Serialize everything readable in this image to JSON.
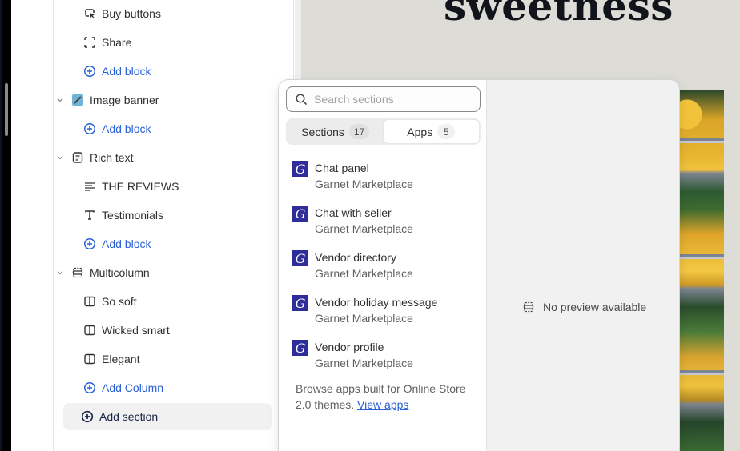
{
  "preview": {
    "headline": "sweetness"
  },
  "sidebar": {
    "items": [
      {
        "type": "block",
        "label": "Buy buttons",
        "icon": "cursor-click-icon"
      },
      {
        "type": "block",
        "label": "Share",
        "icon": "share-frame-icon"
      },
      {
        "type": "add",
        "label": "Add block",
        "icon": "plus-circle-icon"
      },
      {
        "type": "section",
        "label": "Image banner",
        "icon": "image-thumbnail-icon"
      },
      {
        "type": "add",
        "label": "Add block",
        "icon": "plus-circle-icon"
      },
      {
        "type": "section",
        "label": "Rich text",
        "icon": "text-block-icon"
      },
      {
        "type": "block",
        "label": "THE REVIEWS",
        "icon": "text-align-icon"
      },
      {
        "type": "block",
        "label": "Testimonials",
        "icon": "text-t-icon"
      },
      {
        "type": "add",
        "label": "Add block",
        "icon": "plus-circle-icon"
      },
      {
        "type": "section",
        "label": "Multicolumn",
        "icon": "multicolumn-icon"
      },
      {
        "type": "block",
        "label": "So soft",
        "icon": "column-icon"
      },
      {
        "type": "block",
        "label": "Wicked smart",
        "icon": "column-icon"
      },
      {
        "type": "block",
        "label": "Elegant",
        "icon": "column-icon"
      },
      {
        "type": "add",
        "label": "Add Column",
        "icon": "plus-circle-icon"
      }
    ],
    "add_section_label": "Add section"
  },
  "popover": {
    "search_placeholder": "Search sections",
    "search_value": "",
    "tabs": [
      {
        "label": "Sections",
        "count": "17",
        "active": false
      },
      {
        "label": "Apps",
        "count": "5",
        "active": true
      }
    ],
    "apps": [
      {
        "name": "Chat panel",
        "vendor": "Garnet Marketplace",
        "logo_letter": "G"
      },
      {
        "name": "Chat with seller",
        "vendor": "Garnet Marketplace",
        "logo_letter": "G"
      },
      {
        "name": "Vendor directory",
        "vendor": "Garnet Marketplace",
        "logo_letter": "G"
      },
      {
        "name": "Vendor holiday message",
        "vendor": "Garnet Marketplace",
        "logo_letter": "G"
      },
      {
        "name": "Vendor profile",
        "vendor": "Garnet Marketplace",
        "logo_letter": "G"
      }
    ],
    "browse_text": "Browse apps built for Online Store 2.0 themes.",
    "browse_link": "View apps",
    "no_preview": "No preview available"
  },
  "colors": {
    "link_blue": "#2a61d6",
    "app_logo": "#2e2d9a",
    "preview_bg": "#dddcd6"
  }
}
